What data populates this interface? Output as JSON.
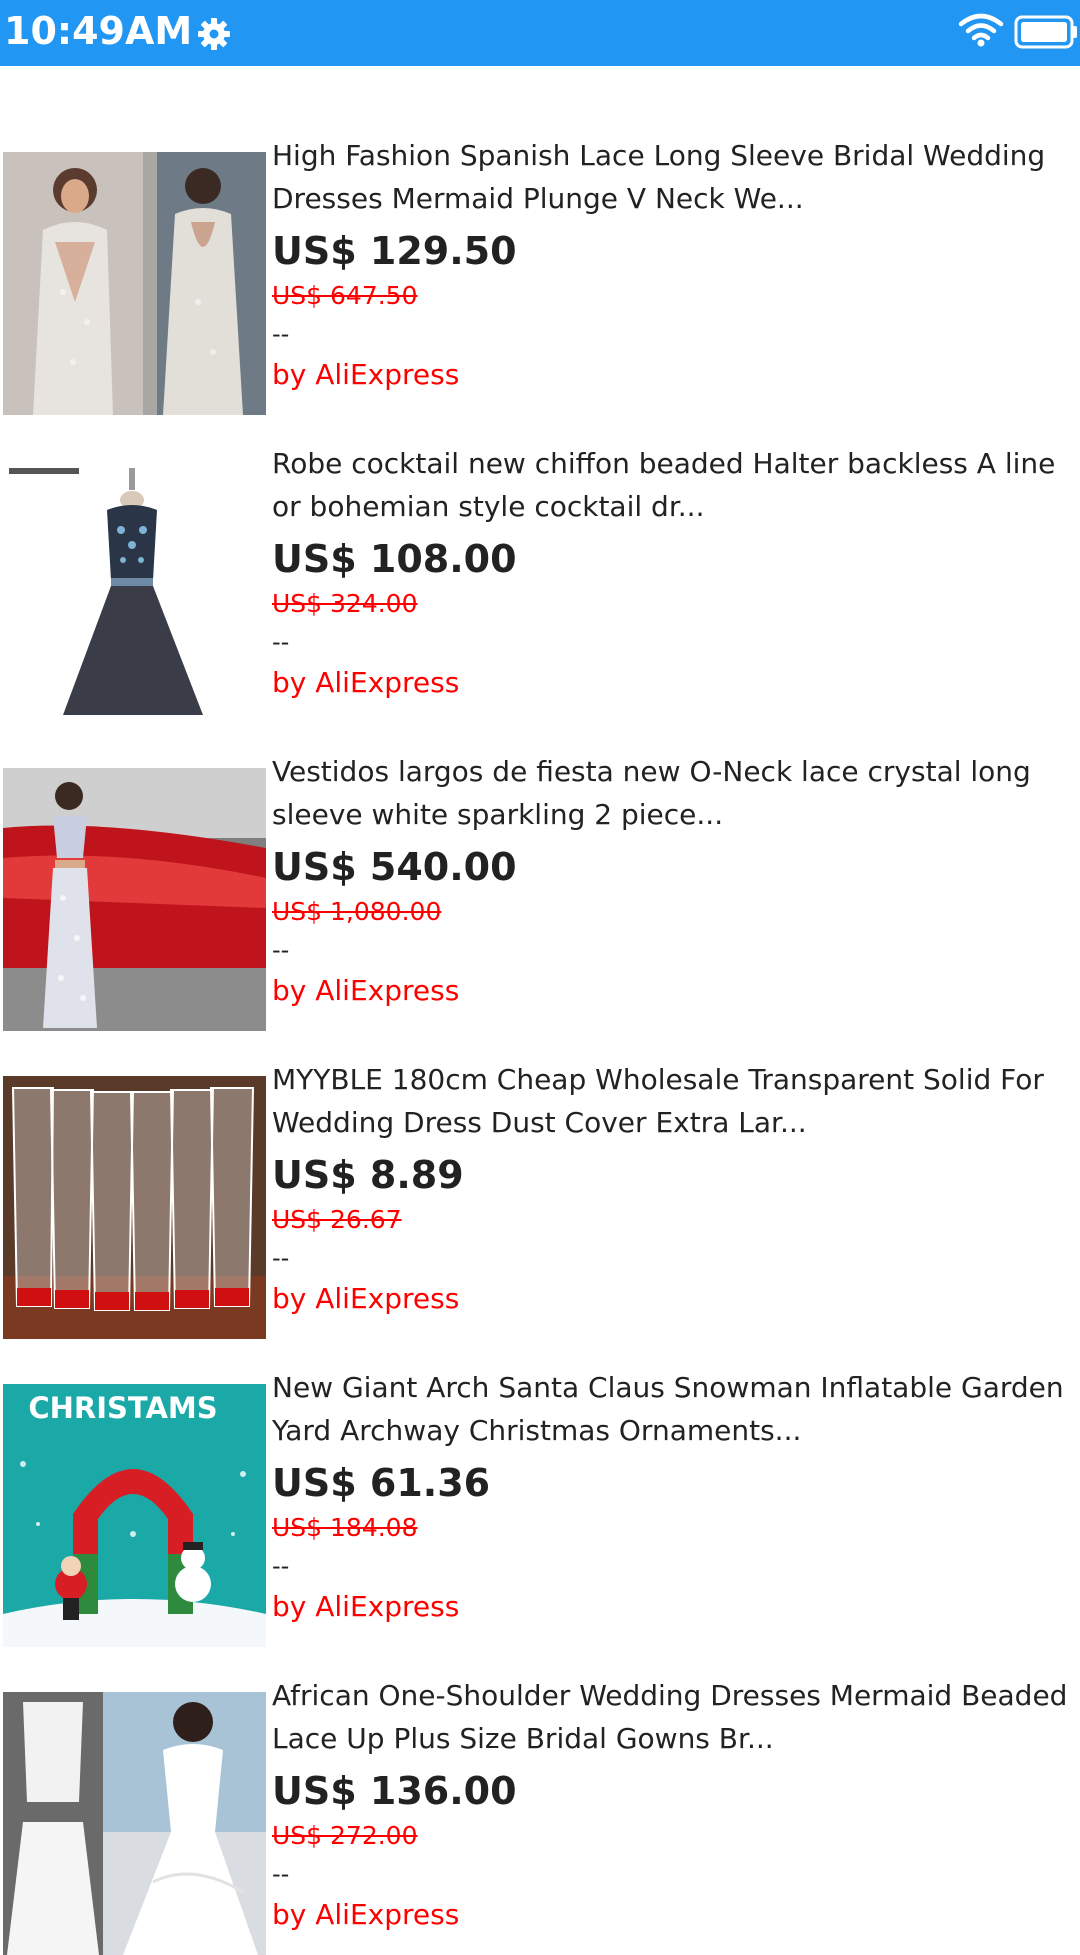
{
  "status_bar": {
    "time": "10:49AM",
    "background": "#2196f3",
    "icons": [
      "gear-icon",
      "wifi-icon",
      "battery-icon"
    ]
  },
  "products": [
    {
      "title": "High Fashion Spanish Lace Long Sleeve Bridal Wedding Dresses Mermaid Plunge V Neck We...",
      "price": "US$ 129.50",
      "original_price": "US$ 647.50",
      "rating": "--",
      "seller": "by AliExpress",
      "image": "bridal-lace-dress-photo"
    },
    {
      "title": "Robe cocktail new chiffon beaded Halter backless A line or bohemian style cocktail dr...",
      "price": "US$ 108.00",
      "original_price": "US$ 324.00",
      "rating": "--",
      "seller": "by AliExpress",
      "image": "cocktail-dress-photo"
    },
    {
      "title": "Vestidos largos de fiesta new O-Neck lace crystal long sleeve white sparkling 2 piece...",
      "price": "US$ 540.00",
      "original_price": "US$ 1,080.00",
      "rating": "--",
      "seller": "by AliExpress",
      "image": "two-piece-gown-photo"
    },
    {
      "title": "MYYBLE 180cm Cheap Wholesale Transparent Solid For Wedding Dress Dust Cover Extra Lar...",
      "price": "US$ 8.89",
      "original_price": "US$ 26.67",
      "rating": "--",
      "seller": "by AliExpress",
      "image": "dress-covers-photo"
    },
    {
      "title": "New Giant Arch Santa Claus Snowman Inflatable Garden Yard Archway Christmas Ornaments...",
      "price": "US$ 61.36",
      "original_price": "US$ 184.08",
      "rating": "--",
      "seller": "by AliExpress",
      "image": "christmas-arch-photo",
      "image_text": "CHRISTAMS"
    },
    {
      "title": "African One-Shoulder Wedding Dresses Mermaid Beaded Lace Up Plus Size Bridal Gowns Br...",
      "price": "US$ 136.00",
      "original_price": "US$ 272.00",
      "rating": "--",
      "seller": "by AliExpress",
      "image": "mermaid-gown-photo"
    }
  ]
}
